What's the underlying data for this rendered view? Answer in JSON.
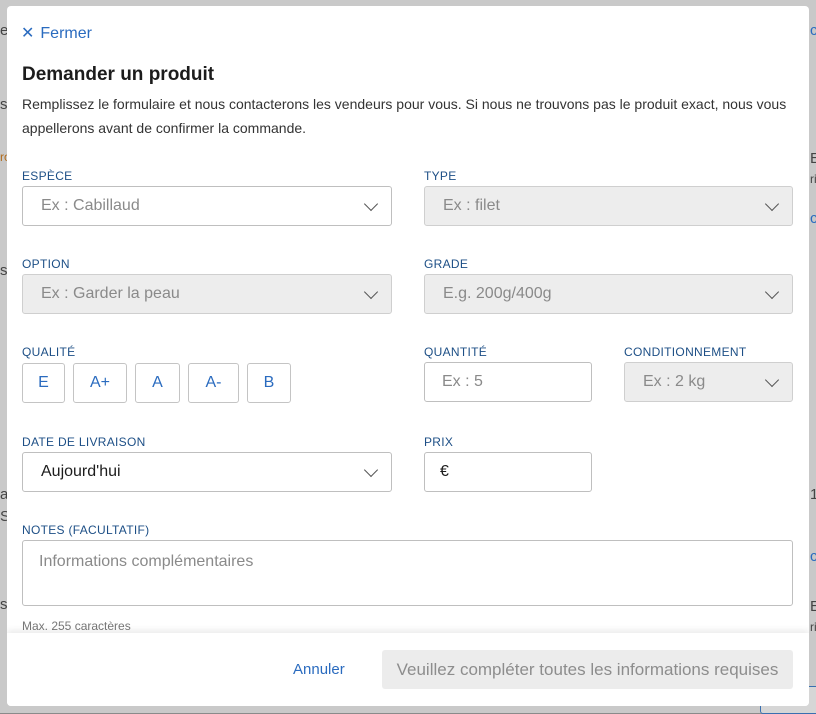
{
  "background": {
    "fragments": [
      "ee",
      "su",
      "ro",
      "su",
      "ar",
      "S",
      "su"
    ],
    "right_fragments": [
      "c",
      "E3",
      "ri",
      "c",
      "1",
      "c",
      "E5",
      "ri"
    ]
  },
  "modal": {
    "close_label": "Fermer",
    "title": "Demander un produit",
    "description": "Remplissez le formulaire et nous contacterons les vendeurs pour vous. Si nous ne trouvons pas le produit exact, nous vous appellerons avant de confirmer la commande."
  },
  "form": {
    "species": {
      "label": "ESPÈCE",
      "placeholder": "Ex : Cabillaud"
    },
    "type": {
      "label": "TYPE",
      "placeholder": "Ex : filet"
    },
    "option": {
      "label": "OPTION",
      "placeholder": "Ex : Garder la peau"
    },
    "grade": {
      "label": "GRADE",
      "placeholder": "E.g. 200g/400g"
    },
    "quality": {
      "label": "QUALITÉ",
      "options": [
        "E",
        "A+",
        "A",
        "A-",
        "B"
      ]
    },
    "quantity": {
      "label": "QUANTITÉ",
      "placeholder": "Ex : 5"
    },
    "packaging": {
      "label": "CONDITIONNEMENT",
      "placeholder": "Ex : 2 kg"
    },
    "delivery_date": {
      "label": "DATE DE LIVRAISON",
      "value": "Aujourd'hui"
    },
    "price": {
      "label": "PRIX",
      "currency": "€"
    },
    "notes": {
      "label": "NOTES (FACULTATIF)",
      "placeholder": "Informations complémentaires",
      "hint": "Max. 255 caractères"
    }
  },
  "footer": {
    "cancel_label": "Annuler",
    "submit_label": "Veuillez compléter toutes les informations requises"
  }
}
